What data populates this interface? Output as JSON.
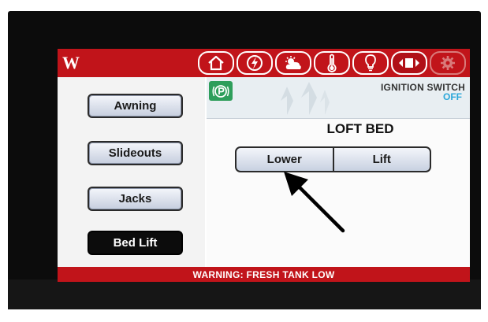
{
  "app": {
    "logo": "W"
  },
  "nav": {
    "tabs": [
      {
        "name": "home",
        "icon": "house-icon"
      },
      {
        "name": "power",
        "icon": "lightning-bolt-icon"
      },
      {
        "name": "climate",
        "icon": "sun-cloud-icon"
      },
      {
        "name": "tanks",
        "icon": "thermometer-icon"
      },
      {
        "name": "lights",
        "icon": "light-bulb-icon"
      },
      {
        "name": "leveling",
        "icon": "motion-arrows-icon",
        "active": true
      },
      {
        "name": "settings",
        "icon": "gear-icon",
        "disabled": true
      }
    ]
  },
  "sidebar": {
    "items": [
      {
        "label": "Awning"
      },
      {
        "label": "Slideouts"
      },
      {
        "label": "Jacks"
      },
      {
        "label": "Bed Lift",
        "selected": true
      }
    ]
  },
  "status": {
    "parking_icon": "parking-brake-icon",
    "ignition_label": "IGNITION SWITCH",
    "ignition_value": "OFF"
  },
  "panel": {
    "title": "LOFT BED",
    "lower_label": "Lower",
    "lift_label": "Lift"
  },
  "warning": {
    "text": "WARNING: FRESH TANK LOW"
  },
  "colors": {
    "brand_red": "#c1141a",
    "ignition_value": "#2aa7d9",
    "parking_green": "#2e9e5b"
  }
}
